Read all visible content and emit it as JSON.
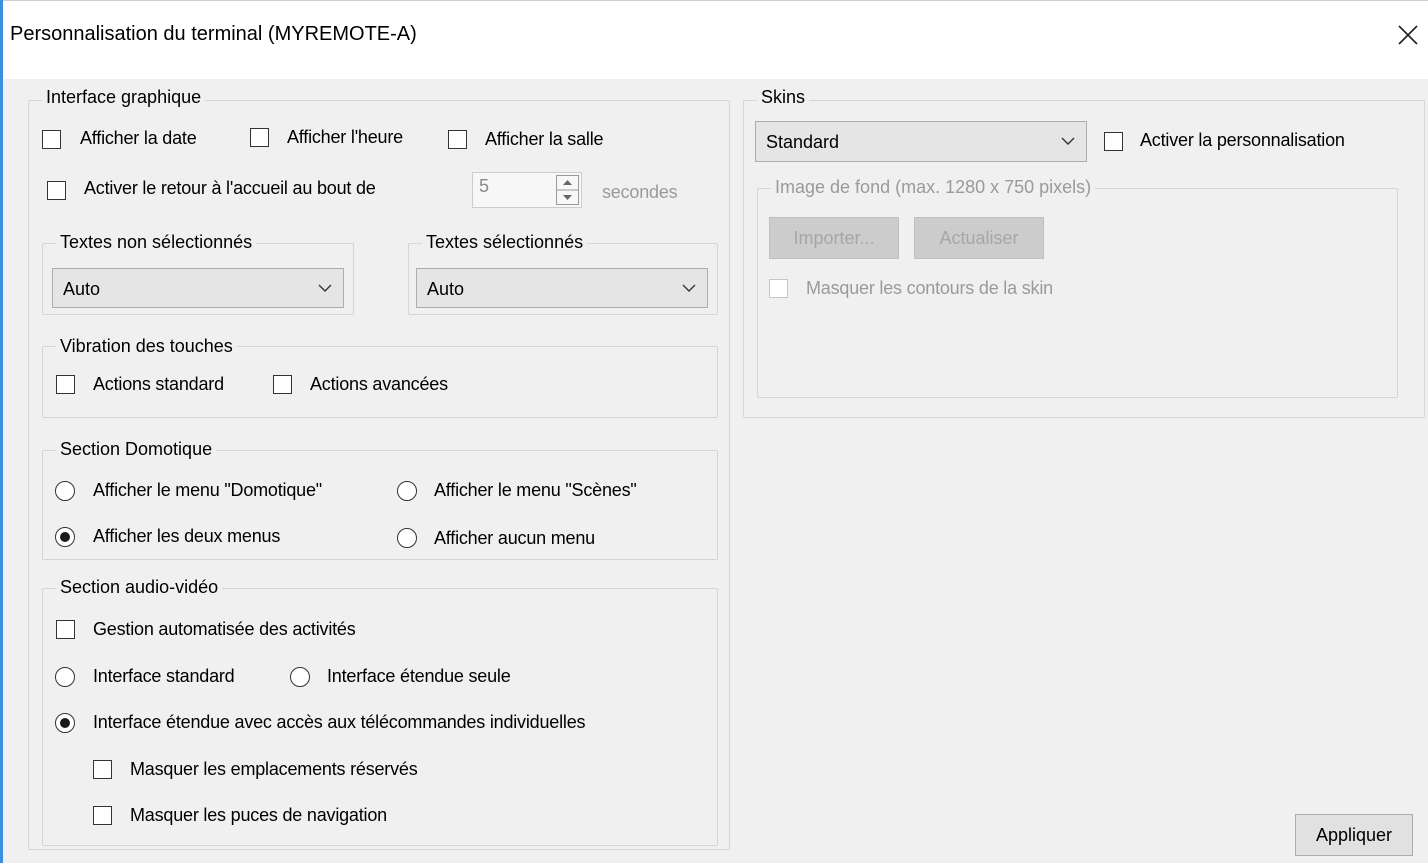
{
  "window": {
    "title": "Personnalisation du terminal (MYREMOTE-A)",
    "close_icon": "close-icon"
  },
  "interface_graphique": {
    "legend": "Interface graphique",
    "show_date": {
      "label": "Afficher la date",
      "checked": false
    },
    "show_time": {
      "label": "Afficher l'heure",
      "checked": false
    },
    "show_room": {
      "label": "Afficher la salle",
      "checked": false
    },
    "return_home": {
      "label": "Activer le retour à l'accueil au bout de",
      "checked": false
    },
    "return_delay": {
      "value": "5",
      "unit": "secondes"
    },
    "unselected_texts": {
      "legend": "Textes non sélectionnés",
      "value": "Auto"
    },
    "selected_texts": {
      "legend": "Textes sélectionnés",
      "value": "Auto"
    }
  },
  "vibration": {
    "legend": "Vibration des touches",
    "standard": {
      "label": "Actions standard",
      "checked": false
    },
    "advanced": {
      "label": "Actions avancées",
      "checked": false
    }
  },
  "domotique": {
    "legend": "Section Domotique",
    "options": [
      {
        "label": "Afficher le menu \"Domotique\"",
        "checked": false
      },
      {
        "label": "Afficher le menu \"Scènes\"",
        "checked": false
      },
      {
        "label": "Afficher les deux menus",
        "checked": true
      },
      {
        "label": "Afficher aucun menu",
        "checked": false
      }
    ]
  },
  "audio_video": {
    "legend": "Section audio-vidéo",
    "auto_activities": {
      "label": "Gestion automatisée des activités",
      "checked": false
    },
    "options": [
      {
        "label": "Interface standard",
        "checked": false
      },
      {
        "label": "Interface étendue seule",
        "checked": false
      },
      {
        "label": "Interface étendue avec accès aux télécommandes individuelles",
        "checked": true
      }
    ],
    "hide_reserved": {
      "label": "Masquer les emplacements réservés",
      "checked": false
    },
    "hide_nav_bullets": {
      "label": "Masquer les puces de navigation",
      "checked": false
    }
  },
  "skins": {
    "legend": "Skins",
    "selected": "Standard",
    "enable_custom": {
      "label": "Activer la personnalisation",
      "checked": false
    },
    "background": {
      "legend": "Image de fond (max. 1280 x 750 pixels)",
      "import_label": "Importer...",
      "refresh_label": "Actualiser",
      "hide_outline": {
        "label": "Masquer les contours de la skin",
        "checked": false
      }
    }
  },
  "apply_label": "Appliquer",
  "colors": {
    "accent": "#3c8fe0",
    "dialog_bg": "#f0f0f0",
    "disabled_text": "#9a9a9a"
  }
}
